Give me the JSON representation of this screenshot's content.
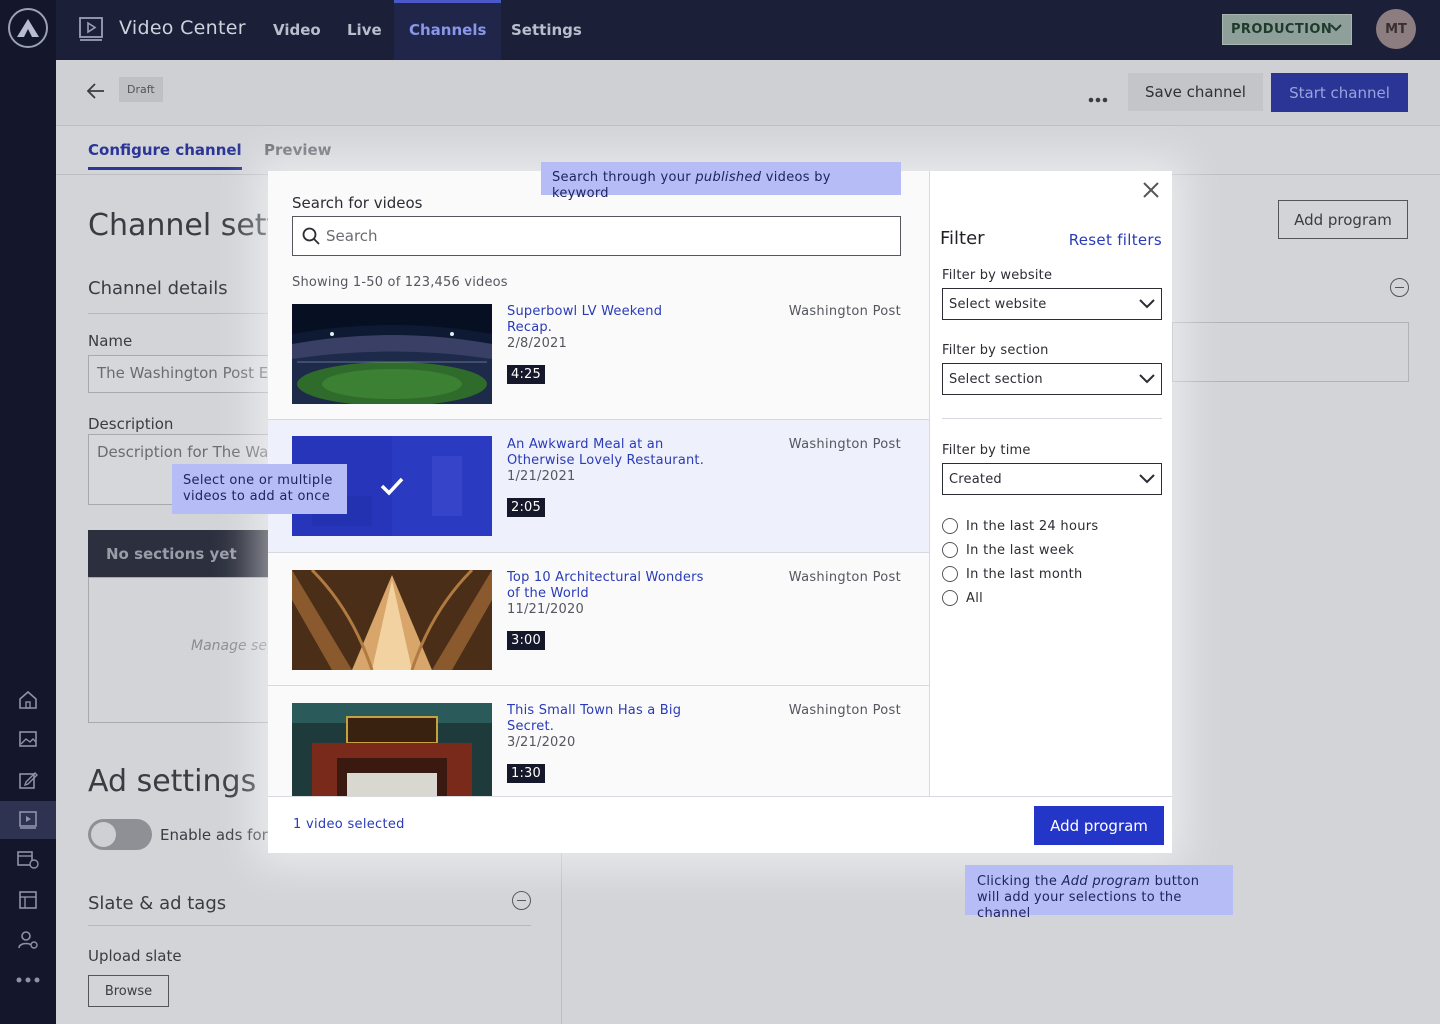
{
  "topbar": {
    "app_title": "Video Center",
    "nav": [
      "Video",
      "Live",
      "Channels",
      "Settings"
    ],
    "active_nav": "Channels",
    "environment": "PRODUCTION",
    "avatar_initials": "MT"
  },
  "pagehead": {
    "status": "Draft",
    "save_label": "Save channel",
    "start_label": "Start channel"
  },
  "tabs": [
    "Configure channel",
    "Preview"
  ],
  "background": {
    "title": "Channel sett",
    "channel_details": "Channel details",
    "name_label": "Name",
    "name_value": "The Washington Post E",
    "description_label": "Description",
    "description_value": "Description for The Wa",
    "no_sections": "No sections yet",
    "manage_sections": "Manage se",
    "ad_settings": "Ad settings",
    "enable_ads": "Enable ads for",
    "slate_tags": "Slate & ad tags",
    "upload_slate": "Upload slate",
    "browse": "Browse",
    "add_program": "Add program"
  },
  "modal": {
    "search_label": "Search for videos",
    "search_placeholder": "Search",
    "count_text": "Showing 1-50 of 123,456 videos",
    "videos": [
      {
        "title": "Superbowl LV Weekend Recap.",
        "date": "2/8/2021",
        "duration": "4:25",
        "source": "Washington Post",
        "selected": false
      },
      {
        "title": "An Awkward Meal at an Otherwise Lovely Restaurant.",
        "date": "1/21/2021",
        "duration": "2:05",
        "source": "Washington Post",
        "selected": true
      },
      {
        "title": "Top 10 Architectural Wonders of the World",
        "date": "11/21/2020",
        "duration": "3:00",
        "source": "Washington Post",
        "selected": false
      },
      {
        "title": "This Small Town Has a Big Secret.",
        "date": "3/21/2020",
        "duration": "1:30",
        "source": "Washington Post",
        "selected": false
      }
    ],
    "filter": {
      "heading": "Filter",
      "reset": "Reset filters",
      "website_label": "Filter by website",
      "website_value": "Select website",
      "section_label": "Filter by section",
      "section_value": "Select section",
      "time_label": "Filter by time",
      "time_value": "Created",
      "time_options": [
        "In the last 24 hours",
        "In the last week",
        "In the last month",
        "All"
      ]
    },
    "footer": {
      "selected_text": "1 video selected",
      "add_label": "Add program"
    }
  },
  "notes": {
    "search_pre": "Search through your ",
    "search_em": "published",
    "search_post": " videos by keyword",
    "select": "Select one or multiple videos to add at once",
    "add_pre": "Clicking the ",
    "add_em": "Add program",
    "add_post": " button will add your selections to the channel"
  },
  "colors": {
    "accent": "#2436c8",
    "link": "#2a3bb8",
    "note_bg": "#b6bcf5",
    "rail": "#14172b"
  }
}
